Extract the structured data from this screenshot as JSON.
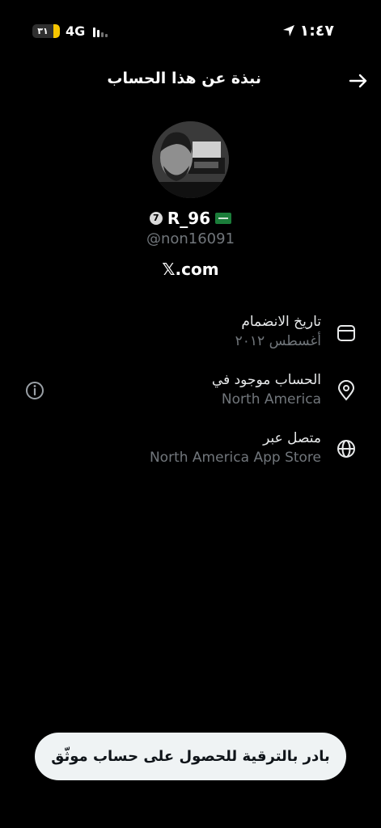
{
  "status_bar": {
    "battery": "٣١",
    "network": "4G",
    "time": "١:٤٧"
  },
  "header": {
    "title": "نبذة عن هذا الحساب"
  },
  "profile": {
    "verified_badge": "7",
    "display_name": "R_96",
    "handle": "@non16091",
    "site": "𝕏.com"
  },
  "info": {
    "joined": {
      "label": "تاريخ الانضمام",
      "value": "أغسطس ٢٠١٢",
      "icon": "calendar-icon"
    },
    "location": {
      "label": "الحساب موجود في",
      "value": "North America",
      "icon": "location-pin-icon"
    },
    "connected": {
      "label": "متصل عبر",
      "value": "North America App Store",
      "icon": "globe-icon"
    }
  },
  "upgrade_button": "بادر بالترقية للحصول على حساب موثّق",
  "colors": {
    "background": "#000000",
    "text": "#e7e9ea",
    "secondary": "#71767b",
    "button_bg": "#eff3f4",
    "battery": "#f7c600"
  }
}
